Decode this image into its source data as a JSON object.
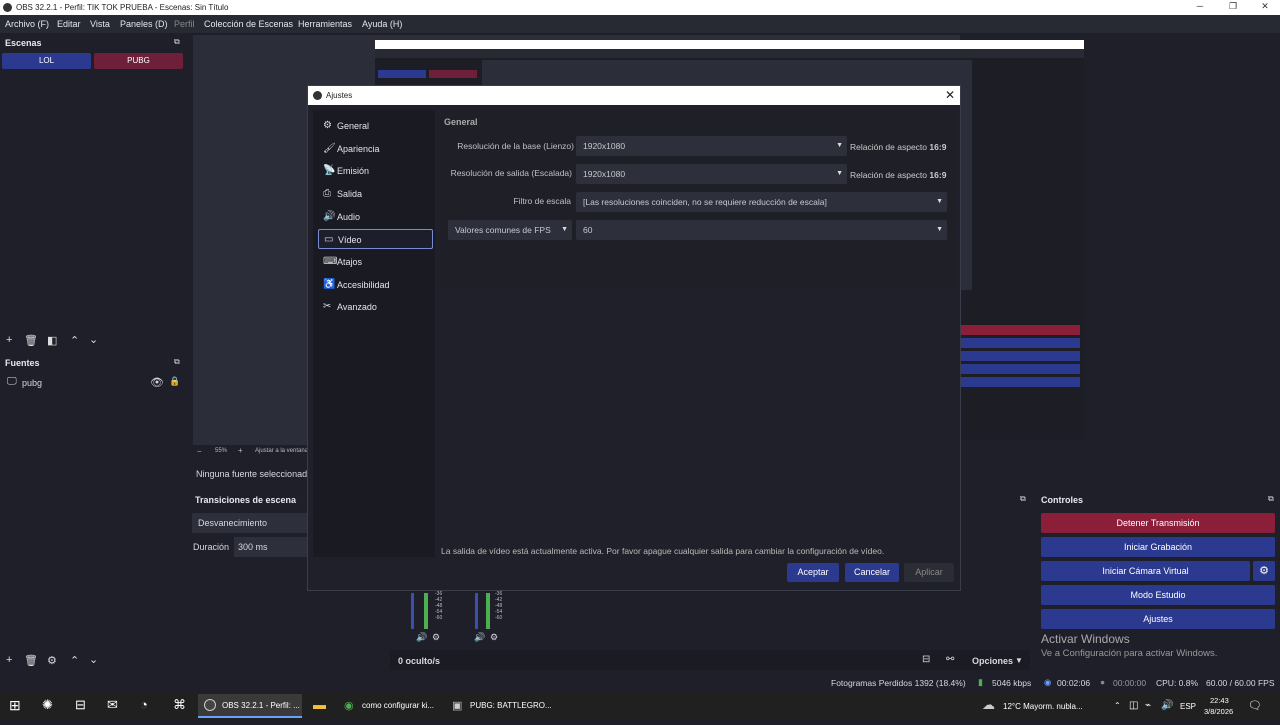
{
  "window": {
    "title": "OBS 32.2.1 - Perfil: TIK TOK PRUEBA - Escenas: Sin Título",
    "minimize": "─",
    "maximize": "❐",
    "close": "✕"
  },
  "menu": [
    "Archivo (F)",
    "Editar",
    "Vista",
    "Paneles (D)",
    "Perfil",
    "Colección de Escenas",
    "Herramientas",
    "Ayuda (H)"
  ],
  "scenes": {
    "title": "Escenas",
    "items": [
      "LOL",
      "PUBG"
    ]
  },
  "sources": {
    "title": "Fuentes",
    "items": [
      {
        "name": "pubg"
      }
    ]
  },
  "preview_bar": {
    "minus": "−",
    "zoom": "55%",
    "plus": "+",
    "fit": "Ajustar a la ventana"
  },
  "no_source": "Ninguna fuente seleccionada",
  "transitions": {
    "title": "Transiciones de escena",
    "selected": "Desvanecimiento",
    "duration_label": "Duración",
    "duration": "300 ms"
  },
  "mixer": {
    "ticks": [
      "-36",
      "-42",
      "-48",
      "-54",
      "-60"
    ],
    "hidden": "0 oculto/s",
    "options": "Opciones"
  },
  "controls": {
    "title": "Controles",
    "stop_stream": "Detener Transmisión",
    "start_record": "Iniciar Grabación",
    "start_vcam": "Iniciar Cámara Virtual",
    "studio": "Modo Estudio",
    "settings": "Ajustes",
    "activate_title": "Activar Windows",
    "activate_sub": "Ve a Configuración para activar Windows."
  },
  "dialog": {
    "title": "Ajustes",
    "nav": [
      {
        "label": "General",
        "icon": "⚙"
      },
      {
        "label": "Apariencia",
        "icon": "🖌"
      },
      {
        "label": "Emisión",
        "icon": "📡"
      },
      {
        "label": "Salida",
        "icon": "⎙"
      },
      {
        "label": "Audio",
        "icon": "🔊"
      },
      {
        "label": "Vídeo",
        "icon": "▭"
      },
      {
        "label": "Atajos",
        "icon": "⌨"
      },
      {
        "label": "Accesibilidad",
        "icon": "♿"
      },
      {
        "label": "Avanzado",
        "icon": "✂"
      }
    ],
    "section": "General",
    "base_res_label": "Resolución de la base (Lienzo)",
    "base_res": "1920x1080",
    "aspect_label": "Relación de aspecto",
    "aspect": "16:9",
    "out_res_label": "Resolución de salida (Escalada)",
    "out_res": "1920x1080",
    "filter_label": "Filtro de escala",
    "filter": "[Las resoluciones coinciden, no se requiere reducción de escala]",
    "fps_label": "Valores comunes de FPS",
    "fps": "60",
    "warning": "La salida de vídeo está actualmente activa. Por favor apague cualquier salida para cambiar la configuración de vídeo.",
    "ok": "Aceptar",
    "cancel": "Cancelar",
    "apply": "Aplicar"
  },
  "status": {
    "dropped": "Fotogramas Perdidos 1392 (18.4%)",
    "kbps": "5046 kbps",
    "stream_time": "00:02:06",
    "rec_time": "00:00:00",
    "cpu": "CPU: 0.8%",
    "fps": "60.00 / 60.00 FPS"
  },
  "taskbar": {
    "obs": "OBS 32.2.1 - Perfil: ...",
    "chrome": "como configurar ki...",
    "pubg": "PUBG: BATTLEGRO...",
    "weather": "12°C  Mayorm. nubla...",
    "lang": "ESP",
    "time": "22:43",
    "date": "3/8/2026"
  },
  "colors": {
    "accent_blue": "#2b3a8f",
    "stop_red": "#8b1f3a",
    "pubg_red": "#6e1f3a"
  }
}
